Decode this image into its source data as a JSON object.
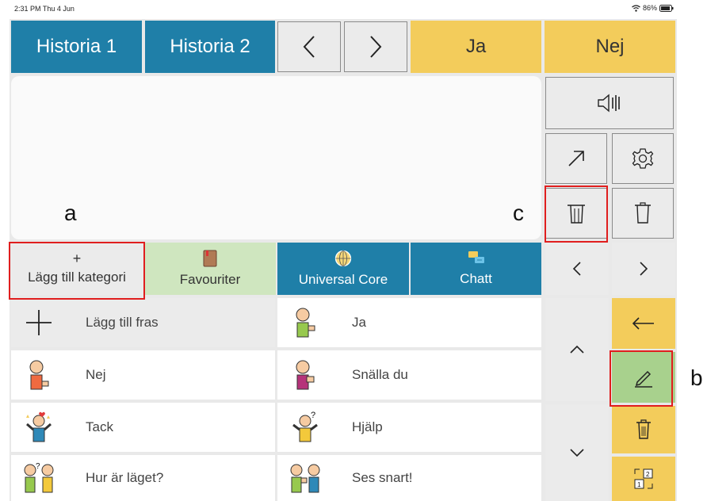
{
  "status_bar": {
    "time_date": "2:31 PM  Thu 4 Jun",
    "battery": "86%"
  },
  "top_row": {
    "history1": "Historia 1",
    "history2": "Historia 2",
    "yes": "Ja",
    "no": "Nej"
  },
  "categories": [
    {
      "label": "Lägg till kategori",
      "icon": "plus-icon"
    },
    {
      "label": "Favouriter",
      "icon": "book-icon"
    },
    {
      "label": "Universal Core",
      "icon": "globe-icon"
    },
    {
      "label": "Chatt",
      "icon": "chat-icon"
    }
  ],
  "phrases": {
    "add_phrase": "Lägg till fras",
    "yes": "Ja",
    "no": "Nej",
    "please": "Snälla du",
    "thanks": "Tack",
    "help": "Hjälp",
    "how_are_you": "Hur är läget?",
    "see_you": "Ses snart!"
  },
  "callouts": {
    "a": "a",
    "b": "b",
    "c": "c"
  },
  "colors": {
    "blue": "#1f7fa8",
    "yellow": "#f3cc5b",
    "green": "#cfe6bf",
    "edit_green": "#a8d18d",
    "highlight": "#e01e1e"
  }
}
